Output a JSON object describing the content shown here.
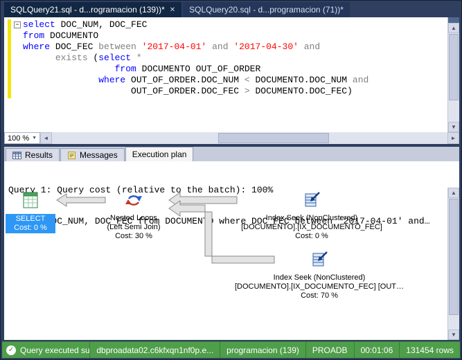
{
  "window_tabs": [
    {
      "label": "SQLQuery21.sql - d...rogramacion (139))*",
      "active": true
    },
    {
      "label": "SQLQuery20.sql - d...programacion (71))*",
      "active": false
    }
  ],
  "glyphs": {
    "up": "▲",
    "down": "▼",
    "left": "◄",
    "right": "►",
    "dropdown": "▼",
    "minus": "−",
    "close": "✕",
    "check": "✓"
  },
  "editor": {
    "zoom_value": "100 %",
    "code_lines": [
      [
        [
          "kw",
          "select"
        ],
        [
          "pl",
          " DOC_NUM, DOC_FEC"
        ]
      ],
      [
        [
          "kw",
          "from"
        ],
        [
          "pl",
          " DOCUMENTO"
        ]
      ],
      [
        [
          "kw",
          "where"
        ],
        [
          "pl",
          " DOC_FEC "
        ],
        [
          "gr",
          "between"
        ],
        [
          "pl",
          " "
        ],
        [
          "str",
          "'2017-04-01'"
        ],
        [
          "pl",
          " "
        ],
        [
          "gr",
          "and"
        ],
        [
          "pl",
          " "
        ],
        [
          "str",
          "'2017-04-30'"
        ],
        [
          "pl",
          " "
        ],
        [
          "gr",
          "and"
        ]
      ],
      [
        [
          "pl",
          "      "
        ],
        [
          "gr",
          "exists"
        ],
        [
          "pl",
          " ("
        ],
        [
          "kw",
          "select"
        ],
        [
          "pl",
          " "
        ],
        [
          "gr",
          "*"
        ]
      ],
      [
        [
          "pl",
          "                 "
        ],
        [
          "kw",
          "from"
        ],
        [
          "pl",
          " DOCUMENTO OUT_OF_ORDER"
        ]
      ],
      [
        [
          "pl",
          "              "
        ],
        [
          "kw",
          "where"
        ],
        [
          "pl",
          " OUT_OF_ORDER.DOC_NUM "
        ],
        [
          "gr",
          "<"
        ],
        [
          "pl",
          " DOCUMENTO.DOC_NUM "
        ],
        [
          "gr",
          "and"
        ]
      ],
      [
        [
          "pl",
          "                    "
        ],
        [
          "pl",
          "OUT_OF_ORDER.DOC_FEC "
        ],
        [
          "gr",
          ">"
        ],
        [
          "pl",
          " DOCUMENTO.DOC_FEC)"
        ]
      ]
    ]
  },
  "results_tabs": [
    {
      "label": "Results",
      "active": false
    },
    {
      "label": "Messages",
      "active": false
    },
    {
      "label": "Execution plan",
      "active": true
    }
  ],
  "plan": {
    "header_line1": "Query 1: Query cost (relative to the batch): 100%",
    "header_line2": "select DOC_NUM, DOC_FEC from DOCUMENTO where DOC_FEC between '2017-04-01' and…",
    "nodes": {
      "select": {
        "line1": "SELECT",
        "line2": "Cost: 0 %"
      },
      "nested_loops": {
        "line1": "Nested Loops",
        "line2": "(Left Semi Join)",
        "line3": "Cost: 30 %"
      },
      "index_seek_top": {
        "line1": "Index Seek (NonClustered)",
        "line2": "[DOCUMENTO].[IX_DOCUMENTO_FEC]",
        "line3": "Cost: 0 %"
      },
      "index_seek_bottom": {
        "line1": "Index Seek (NonClustered)",
        "line2": "[DOCUMENTO].[IX_DOCUMENTO_FEC] [OUT…",
        "line3": "Cost: 70 %"
      }
    }
  },
  "status_bar": {
    "message": "Query executed succe...",
    "server": "dbproadata02.c6kfxqn1nf0p.e...",
    "login": "programacion (139)",
    "database": "PROADB",
    "duration": "00:01:06",
    "rows": "131454 rows"
  },
  "colors": {
    "frame_blue": "#2e3f60",
    "select_highlight_blue": "#2e97f5",
    "status_green": "#4f9e4a",
    "keyword_blue": "#0000ff",
    "string_red": "#ff0000",
    "operator_gray": "#808080",
    "change_bar_yellow": "#f2e40c"
  }
}
